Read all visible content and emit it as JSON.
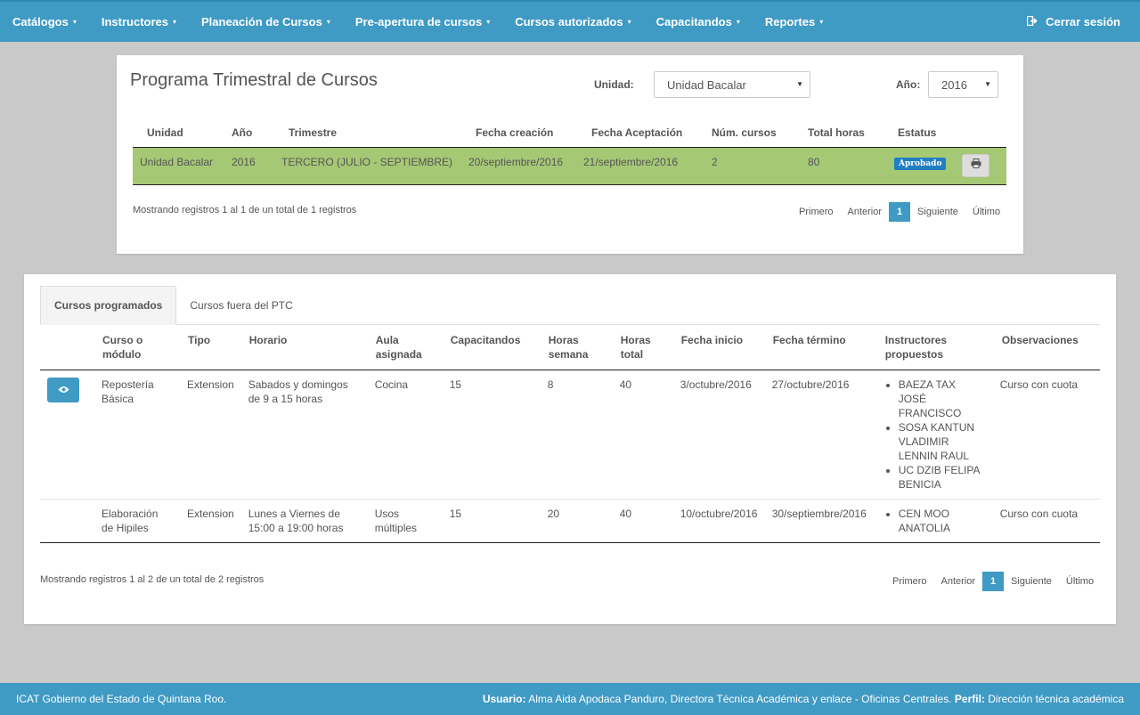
{
  "nav": {
    "items": [
      {
        "label": "Catálogos",
        "name": "catalogos"
      },
      {
        "label": "Instructores",
        "name": "instructores"
      },
      {
        "label": "Planeación de Cursos",
        "name": "planeacion-cursos"
      },
      {
        "label": "Pre-apertura de cursos",
        "name": "pre-apertura"
      },
      {
        "label": "Cursos autorizados",
        "name": "cursos-autorizados"
      },
      {
        "label": "Capacitandos",
        "name": "capacitandos"
      },
      {
        "label": "Reportes",
        "name": "reportes"
      }
    ],
    "caret": "▾",
    "logout_icon": "sign-out-icon",
    "logout_label": "Cerrar sesión"
  },
  "ptc": {
    "title": "Programa Trimestral de Cursos",
    "unidad_label": "Unidad:",
    "unidad_value": "Unidad Bacalar",
    "anio_label": "Año:",
    "anio_value": "2016",
    "headers": [
      "Unidad",
      "Año",
      "Trimestre",
      "Fecha creación",
      "Fecha Aceptación",
      "Núm. cursos",
      "Total horas",
      "Estatus"
    ],
    "row": {
      "unidad": "Unidad Bacalar",
      "anio": "2016",
      "trimestre": "TERCERO (JULIO - SEPTIEMBRE)",
      "fecha_creacion": "20/septiembre/2016",
      "fecha_aceptacion": "21/septiembre/2016",
      "num_cursos": "2",
      "total_horas": "80",
      "estatus": "Aprobado",
      "print_icon": "print-icon"
    },
    "records_info": "Mostrando registros 1 al 1 de un total de 1 registros",
    "pager": {
      "first": "Primero",
      "prev": "Anterior",
      "current": "1",
      "next": "Siguiente",
      "last": "Último"
    }
  },
  "cursos": {
    "tabs": [
      "Cursos programados",
      "Cursos fuera del PTC"
    ],
    "headers": {
      "curso": "Curso o módulo",
      "tipo": "Tipo",
      "horario": "Horario",
      "aula": "Aula asignada",
      "capacitandos": "Capacitandos",
      "horas_semana": "Horas semana",
      "horas_total": "Horas total",
      "fecha_inicio": "Fecha inicio",
      "fecha_termino": "Fecha término",
      "instructores": "Instructores propuestos",
      "observaciones": "Observaciones"
    },
    "rows": [
      {
        "curso": "Repostería Básica",
        "tipo": "Extension",
        "horario": "Sabados y domingos de 9 a 15 horas",
        "aula": "Cocina",
        "capacitandos": "15",
        "horas_semana": "8",
        "horas_total": "40",
        "fecha_inicio": "3/octubre/2016",
        "fecha_termino": "27/octubre/2016",
        "instructores": [
          "BAEZA TAX JOSÉ FRANCISCO",
          "SOSA KANTUN VLADIMIR LENNIN RAUL",
          "UC DZIB FELIPA BENICIA"
        ],
        "observaciones": "Curso con cuota",
        "view_icon": "eye-icon"
      },
      {
        "curso": "Elaboración de Hipiles",
        "tipo": "Extension",
        "horario": "Lunes a Viernes de 15:00 a 19:00 horas",
        "aula": "Usos múltiples",
        "capacitandos": "15",
        "horas_semana": "20",
        "horas_total": "40",
        "fecha_inicio": "10/octubre/2016",
        "fecha_termino": "30/septiembre/2016",
        "instructores": [
          "CEN MOO ANATOLIA"
        ],
        "observaciones": "Curso con cuota"
      }
    ],
    "records_info": "Mostrando registros 1 al 2 de un total de 2 registros",
    "pager": {
      "first": "Primero",
      "prev": "Anterior",
      "current": "1",
      "next": "Siguiente",
      "last": "Último"
    }
  },
  "footer": {
    "left": "ICAT Gobierno del Estado de Quintana Roo.",
    "user_label": "Usuario:",
    "user_value": "Alma Aida Apodaca Panduro, Directora Técnica Académica y enlace - Oficinas Centrales.",
    "profile_label": "Perfil:",
    "profile_value": "Dirección técnica académica"
  },
  "colors": {
    "brand": "#3f9ac4",
    "row_highlight": "#a5c875",
    "badge": "#1f7fc2",
    "background": "#c9c9c9"
  }
}
